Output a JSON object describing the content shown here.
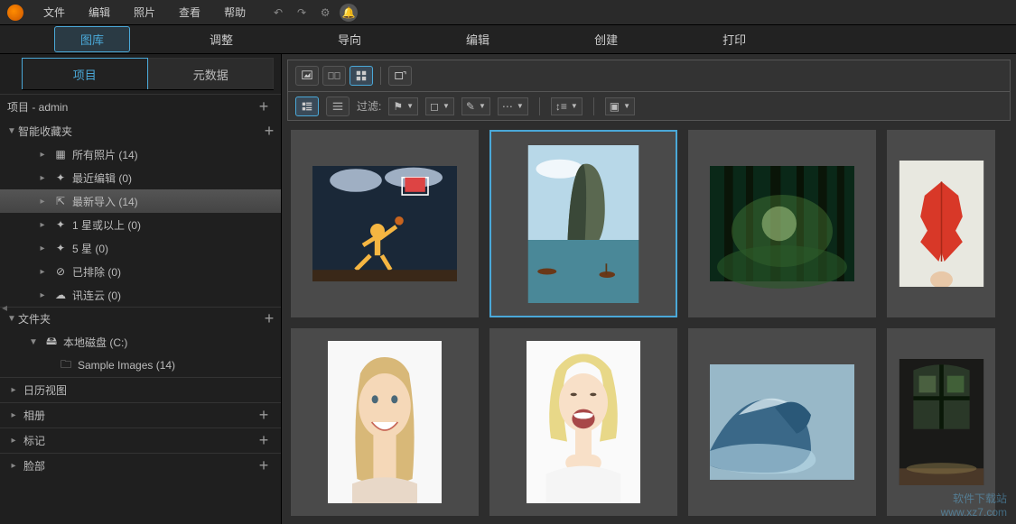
{
  "menu": {
    "file": "文件",
    "edit": "编辑",
    "photo": "照片",
    "view": "查看",
    "help": "帮助"
  },
  "modules": {
    "library": "图库",
    "adjust": "调整",
    "guide": "导向",
    "edit": "编辑",
    "create": "创建",
    "print": "打印"
  },
  "side_tabs": {
    "project": "项目",
    "metadata": "元数据"
  },
  "project_header": "项目 - admin",
  "tree": {
    "smart": {
      "label": "智能收藏夹",
      "all": "所有照片 (14)",
      "recent_edit": "最近编辑 (0)",
      "recent_import": "最新导入 (14)",
      "one_star": "1 星或以上 (0)",
      "five_star": "5 星 (0)",
      "excluded": "已排除 (0)",
      "cloud": "讯连云 (0)"
    },
    "folders": {
      "label": "文件夹",
      "drive": "本地磁盘 (C:)",
      "sample": "Sample Images (14)"
    },
    "calendar": "日历视图",
    "album": "相册",
    "tag": "标记",
    "face": "脸部"
  },
  "toolbar": {
    "filter_label": "过滤:"
  },
  "watermark": {
    "line1": "软件下载站",
    "line2": "www.xz7.com"
  }
}
